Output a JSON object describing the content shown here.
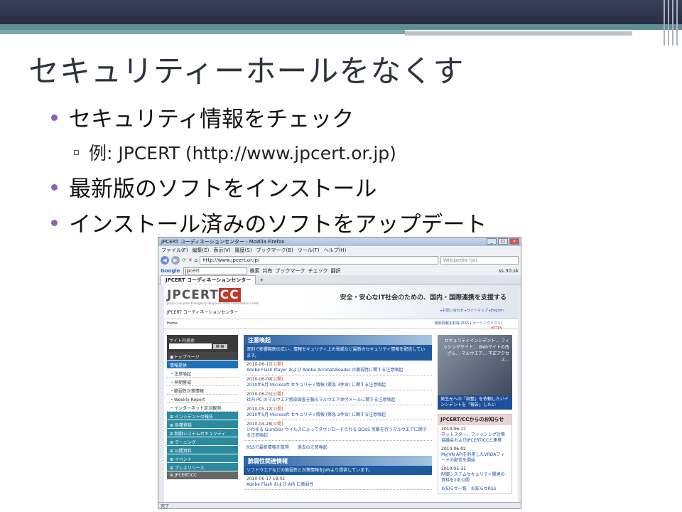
{
  "slide": {
    "title": "セキュリティーホールをなくす",
    "bullets": [
      "セキュリティ情報をチェック",
      "最新版のソフトをインストール",
      "インストール済みのソフトをアップデート"
    ],
    "sub": "例: JPCERT (http://www.jpcert.or.jp)"
  },
  "browser": {
    "title": "JPCERT コーディネーションセンター - Mozilla Firefox",
    "menu": [
      "ファイル(F)",
      "編集(E)",
      "表示(V)",
      "履歴(S)",
      "ブックマーク(B)",
      "ツール(T)",
      "ヘルプ(H)"
    ],
    "url": "http://www.jpcert.or.jp/",
    "search_placeholder": "Wikipedia (ja)",
    "google_label": "Google",
    "google_query": "jpcert",
    "gbar": [
      "検索",
      "共有",
      "ブックマーク",
      "チェック",
      "翻訳"
    ],
    "gbar_right": "ss.30.sk",
    "tab": "JPCERT コーディネーションセンター",
    "status": "完了"
  },
  "site": {
    "logo_a": "JPCERT",
    "logo_b": "CC",
    "logo_sub": "Japan Computer Emergency Response Team Coordination Center",
    "org": "JPCERT コーディネーションセンター",
    "tagline": "安全・安心なIT社会のための、国内・国際連携を支援する",
    "toplinks": "▸お問い合わせ ▸サイトマップ ▸English",
    "crumb": "Home",
    "rss": "最新情報を取得 (RSS | メーリングリスト)",
    "https": "HTTPS",
    "search_label": "サイト内検索",
    "search_btn": "検 索",
    "menu": [
      {
        "label": "▣トップページ",
        "cls": "dark"
      },
      {
        "label": "情報提供",
        "cls": "blue"
      },
      {
        "label": "・注意喚起",
        "cls": "sub"
      },
      {
        "label": "・早期警戒",
        "cls": "sub"
      },
      {
        "label": "・脆弱性対策情報",
        "cls": "sub"
      },
      {
        "label": "・Weekly Report",
        "cls": "sub"
      },
      {
        "label": "・インターネット定点観測",
        "cls": "sub"
      },
      {
        "label": "⊞ インシデントの報告",
        "cls": "teal"
      },
      {
        "label": "⊞ 各種登録",
        "cls": "teal"
      },
      {
        "label": "⊞ 制御システムセキュリティ",
        "cls": "teal"
      },
      {
        "label": "⊞ ラーニング",
        "cls": "teal"
      },
      {
        "label": "⊞ 公開資料",
        "cls": "teal"
      },
      {
        "label": "⊞ イベント",
        "cls": "teal"
      },
      {
        "label": "⊞ プレスリリース",
        "cls": "teal"
      },
      {
        "label": "⊞ JPCERT/CC",
        "cls": "gray"
      }
    ],
    "alerts_title": "注意喚起",
    "alerts_desc": "深刻で影響範囲の広い、情報セキュリティ上の脅威など最新のセキュリティ情報を配信しています。",
    "alerts": [
      {
        "date": "2010-06-11",
        "tag": "[公開]",
        "text": "Adobe Flash Player および Adobe Acrobat/Reader の脆弱性に関する注意喚起"
      },
      {
        "date": "2010-06-09",
        "tag": "[公開]",
        "text": "2010年6月 Microsoft セキュリティ情報 (緊急 3件含) に関する注意喚起"
      },
      {
        "date": "2010-06-01",
        "tag": "[公開]",
        "text": "社内 PC のマルウエア感染調査を騙るマルウエア添付メールに関する注意喚起"
      },
      {
        "date": "2010-05-12",
        "tag": "[公開]",
        "text": "2010年5月 Microsoft セキュリティ情報 (緊急 2件含) に関する注意喚起"
      },
      {
        "date": "2010-04-28",
        "tag": "[公開]",
        "text": "いわゆる Gumblar ウイルスによってダウンロードされる DDoS 攻撃を行うマルウエアに関する注意喚起"
      }
    ],
    "alerts_links": "RSSで最新情報を取得　　過去の注意喚起",
    "vuln_title": "脆弱性関連情報",
    "vuln_desc": "ソフトウエアなどの脆弱性と対策情報をJVNより提供しています。",
    "vuln_item": {
      "date": "2010-06-17 18:02",
      "text": "Adobe Flash および AIR に脆弱性"
    },
    "banner": "セキュリティインシデント… フィッシングサイト… Webサイトの改ざん… マルウエア… 不正アクセス…",
    "banner_caption": "発生元への「調整」を依頼したいインシデントを「報告」したい",
    "news_title": "JPCERT/CCからのお知らせ",
    "news": [
      {
        "date": "2010-06-17",
        "text": "ネットスター、フィッシング対策協議会およびJPCERT/CCと連携"
      },
      {
        "date": "2010-06-02",
        "text": "MyJVN APIを利用したVRDAフィードの配信を開始"
      },
      {
        "date": "2010-05-31",
        "text": "制御システムセキュリティ関連の資料を2本公開"
      }
    ],
    "news_links": "お知らせ一覧　お知らせRSS"
  }
}
